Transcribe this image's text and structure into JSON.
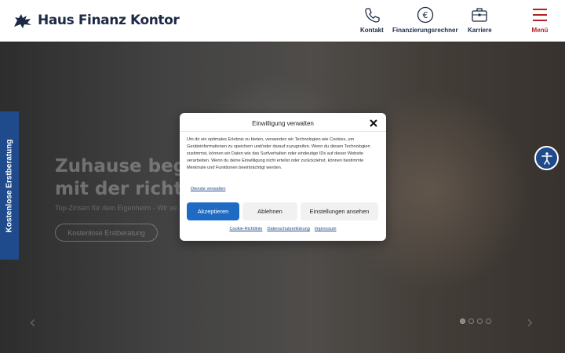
{
  "header": {
    "logo_text": "Haus Finanz Kontor",
    "nav": [
      {
        "label": "Kontakt",
        "icon": "phone-icon"
      },
      {
        "label": "Finanzierungsrechner",
        "icon": "euro-icon"
      },
      {
        "label": "Karriere",
        "icon": "briefcase-icon"
      },
      {
        "label": "Menü",
        "icon": "hamburger-icon"
      }
    ]
  },
  "hero": {
    "title_line1": "Zuhause beg",
    "title_line2": "mit der richt",
    "subtitle": "Top-Zinsen für dein Eigenheim - Wir ve",
    "cta_label": "Kostenlose Erstberatung"
  },
  "side_tab": {
    "label": "Kostenlose Erstberatung"
  },
  "slider": {
    "dots": 4,
    "active_dot": 1
  },
  "consent": {
    "title": "Einwilligung verwalten",
    "body": "Um dir ein optimales Erlebnis zu bieten, verwenden wir Technologien wie Cookies, um Geräteinformationen zu speichern und/oder darauf zuzugreifen. Wenn du diesen Technologien zustimmst, können wir Daten wie das Surfverhalten oder eindeutige IDs auf dieser Website verarbeiten. Wenn du deine Einwilligung nicht erteilst oder zurückziehst, können bestimmte Merkmale und Funktionen beeinträchtigt werden.",
    "manage_link": "Dienste verwalten",
    "accept": "Akzeptieren",
    "deny": "Ablehnen",
    "settings": "Einstellungen ansehen",
    "footer_links": [
      "Cookie-Richtlinie",
      "Datenschutzerklärung",
      "Impressum"
    ]
  },
  "colors": {
    "brand_navy": "#1c2a44",
    "brand_blue": "#1f4a8c",
    "accept_blue": "#1f6bc4",
    "menu_red": "#b22222"
  }
}
